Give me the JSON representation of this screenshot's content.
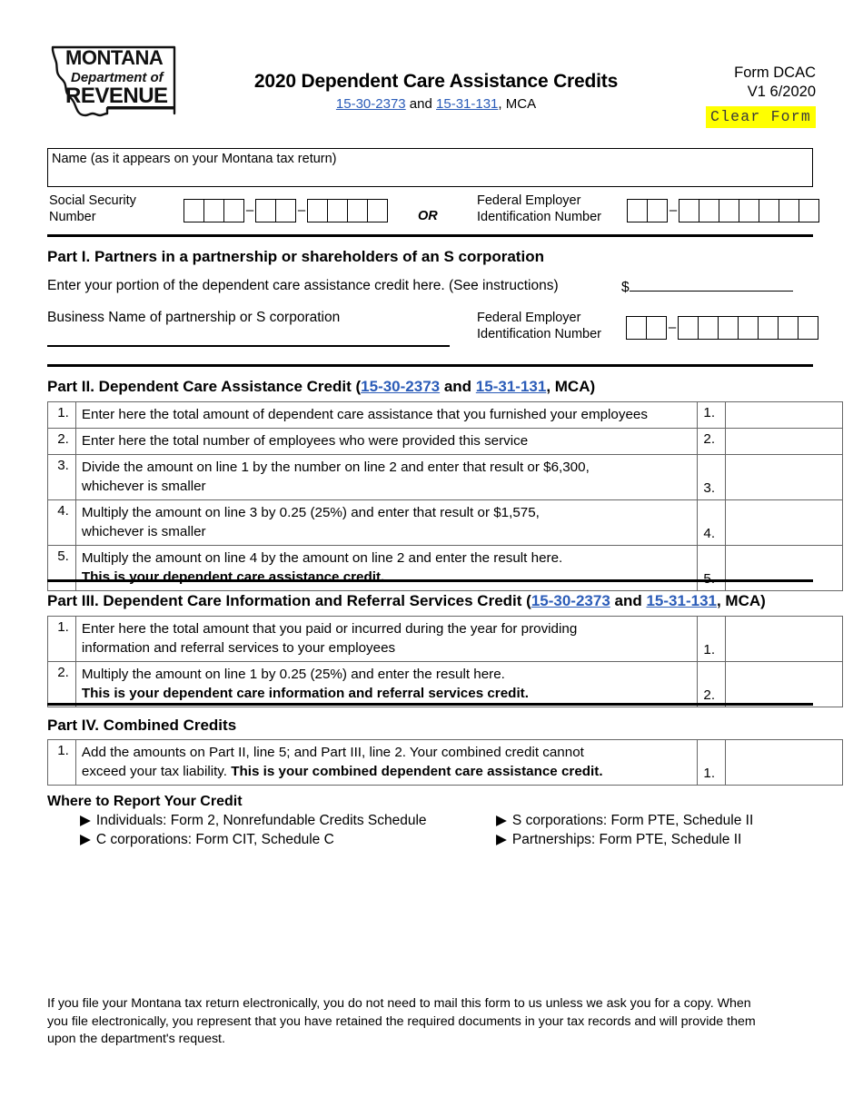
{
  "header": {
    "logo_alt": "Montana Department of Revenue",
    "logo_line1": "MONTANA",
    "logo_line2": "Department of",
    "logo_line3": "REVENUE",
    "title": "2020 Dependent Care Assistance Credits",
    "subtitle_link1": "15-30-2373",
    "subtitle_mid": " and ",
    "subtitle_link2": "15-31-131",
    "subtitle_tail": ", MCA",
    "form_number": "Form DCAC",
    "form_version": "V1 6/2020",
    "clear_form_label": "Clear Form",
    "link_color": "#2b5cb8",
    "highlight_color": "#ffff00"
  },
  "identity": {
    "name_label": "Name (as it appears on your Montana tax return)",
    "name_value": "",
    "ssn_label": "Social Security\nNumber",
    "ssn_label_line1": "Social Security",
    "ssn_label_line2": "Number",
    "ssn_groups": [
      3,
      2,
      4
    ],
    "or_label": "OR",
    "fein_label_line1": "Federal Employer",
    "fein_label_line2": "Identification Number",
    "fein_groups": [
      2,
      7
    ]
  },
  "part1": {
    "heading": "Part I. Partners in a partnership or shareholders of an S corporation",
    "line1_text": "Enter your portion of the dependent care assistance credit here. (See instructions)",
    "dollar_sign": "$",
    "amount_value": "",
    "business_name_label": "Business Name of partnership or S corporation",
    "business_name_value": "",
    "fein_label_line1": "Federal Employer",
    "fein_label_line2": "Identification Number",
    "fein_groups": [
      2,
      7
    ]
  },
  "part2": {
    "heading_bold": "Part II. Dependent Care Assistance Credit",
    "heading_paren_open": " (",
    "heading_link1": "15-30-2373",
    "heading_mid": " and ",
    "heading_link2": "15-31-131",
    "heading_tail": ", MCA)",
    "rows": [
      {
        "num": "1.",
        "text": "Enter here the total amount of dependent care assistance that you furnished your employees",
        "text2": "",
        "bold2": false,
        "rnum": "1.",
        "value": "",
        "tall": false
      },
      {
        "num": "2.",
        "text": "Enter here the total number of employees who were provided this service",
        "text2": "",
        "bold2": false,
        "rnum": "2.",
        "value": "",
        "tall": false
      },
      {
        "num": "3.",
        "text": "Divide the amount on line 1 by the number on line 2 and enter that result or $6,300,",
        "text2": "whichever is smaller",
        "bold2": false,
        "rnum": "3.",
        "value": "",
        "tall": true
      },
      {
        "num": "4.",
        "text": "Multiply the amount on line 3 by 0.25 (25%) and enter that result or $1,575,",
        "text2": "whichever is smaller",
        "bold2": false,
        "rnum": "4.",
        "value": "",
        "tall": true
      },
      {
        "num": "5.",
        "text": "Multiply the amount on line 4 by the amount on line 2 and enter the result here.",
        "text2": "This is your dependent care assistance credit.",
        "bold2": true,
        "rnum": "5.",
        "value": "",
        "tall": true
      }
    ]
  },
  "part3": {
    "heading_bold": "Part III. Dependent Care Information and Referral Services Credit",
    "heading_paren_open": " (",
    "heading_link1": "15-30-2373",
    "heading_mid": " and ",
    "heading_link2": "15-31-131",
    "heading_tail": ", MCA)",
    "rows": [
      {
        "num": "1.",
        "text": "Enter here the total amount that you paid or incurred during the year for providing",
        "text2": "information and referral services to your employees",
        "bold2": false,
        "rnum": "1.",
        "value": "",
        "tall": true
      },
      {
        "num": "2.",
        "text": "Multiply the amount on line 1 by 0.25 (25%) and enter the result here.",
        "text2": "This is your dependent care information and referral services credit.",
        "bold2": true,
        "rnum": "2.",
        "value": "",
        "tall": true
      }
    ]
  },
  "part4": {
    "heading": "Part IV. Combined Credits",
    "rows": [
      {
        "num": "1.",
        "text": "Add the amounts on Part II, line 5; and Part III, line 2. Your combined credit cannot",
        "text2a": "exceed your tax liability. ",
        "text2b": "This is your combined dependent care assistance credit.",
        "rnum": "1.",
        "value": "",
        "tall": true
      }
    ]
  },
  "where_to_report": {
    "heading": "Where to Report Your Credit",
    "arrow_glyph": "▶",
    "left_items": [
      "Individuals: Form 2, Nonrefundable Credits Schedule",
      "C corporations: Form CIT, Schedule C"
    ],
    "right_items": [
      "S corporations: Form PTE, Schedule II",
      "Partnerships: Form PTE, Schedule II"
    ]
  },
  "footer": {
    "text": "If you file your Montana tax return electronically, you do not need to mail this form to us unless we ask you for a copy. When you file electronically, you represent that you have retained the required documents in your tax records and will provide them upon the department's request."
  }
}
